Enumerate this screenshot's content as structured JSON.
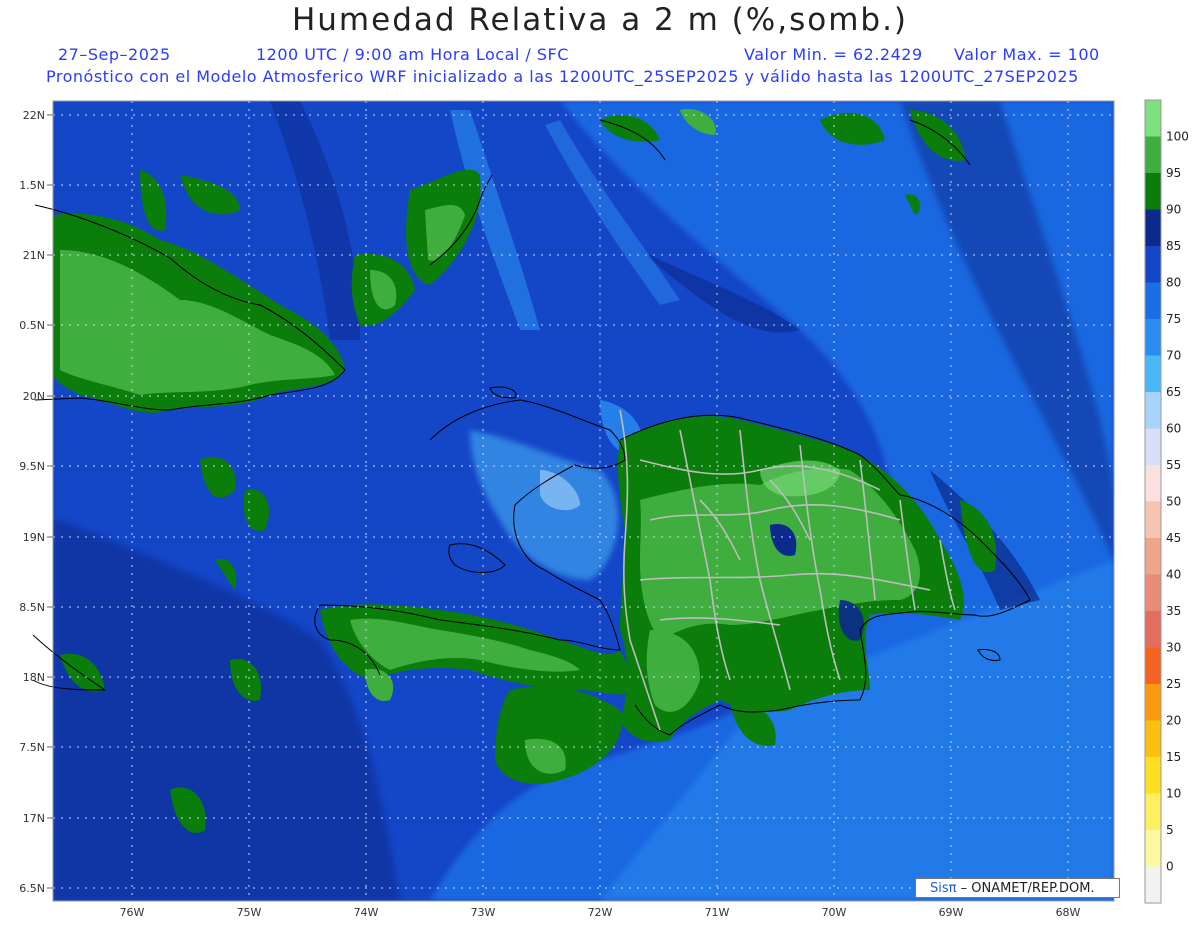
{
  "title": "Humedad Relativa a 2 m (%,somb.)",
  "header": {
    "date": "27–Sep–2025",
    "time_line": "1200 UTC / 9:00 am Hora Local / SFC",
    "min_label": "Valor Min. = 62.2429",
    "max_label": "Valor Max. = 100",
    "forecast_line": "Pronóstico con el Modelo Atmosferico WRF inicializado a las 1200UTC_25SEP2025 y válido hasta las  1200UTC_27SEP2025"
  },
  "lat_labels": [
    "22N",
    "1.5N",
    "21N",
    "0.5N",
    "20N",
    "9.5N",
    "19N",
    "8.5N",
    "18N",
    "7.5N",
    "17N",
    "6.5N"
  ],
  "lon_labels": [
    "76W",
    "75W",
    "74W",
    "73W",
    "72W",
    "71W",
    "70W",
    "69W",
    "68W"
  ],
  "colorbar": {
    "labels": [
      "100",
      "95",
      "90",
      "85",
      "80",
      "75",
      "70",
      "65",
      "60",
      "55",
      "50",
      "45",
      "40",
      "35",
      "30",
      "25",
      "20",
      "15",
      "10",
      "5",
      "0"
    ],
    "colors": [
      "#7fe07f",
      "#3fae3f",
      "#0a7d0a",
      "#0b2a8c",
      "#1446c8",
      "#1a6ee6",
      "#2a8cf0",
      "#4ab8f8",
      "#a8d4fa",
      "#d7def8",
      "#fbe0e0",
      "#f6c4b0",
      "#eea58a",
      "#e88c78",
      "#e46e5e",
      "#f46420",
      "#fa9a10",
      "#fcc010",
      "#fde020",
      "#fdef60",
      "#fdf9a0",
      "#f2f2f2"
    ]
  },
  "credit": {
    "brand": "Sisπ",
    "text": "– ONAMET/REP.DOM."
  },
  "colors": {
    "title": "#222222",
    "header_text": "#2a3cff",
    "ocean_dark": "#0b2a8c",
    "ocean_mid": "#1446c8",
    "ocean_light": "#1a6ee6",
    "land_high_rh": "#3fae3f",
    "land_green": "#0a7d0a"
  }
}
